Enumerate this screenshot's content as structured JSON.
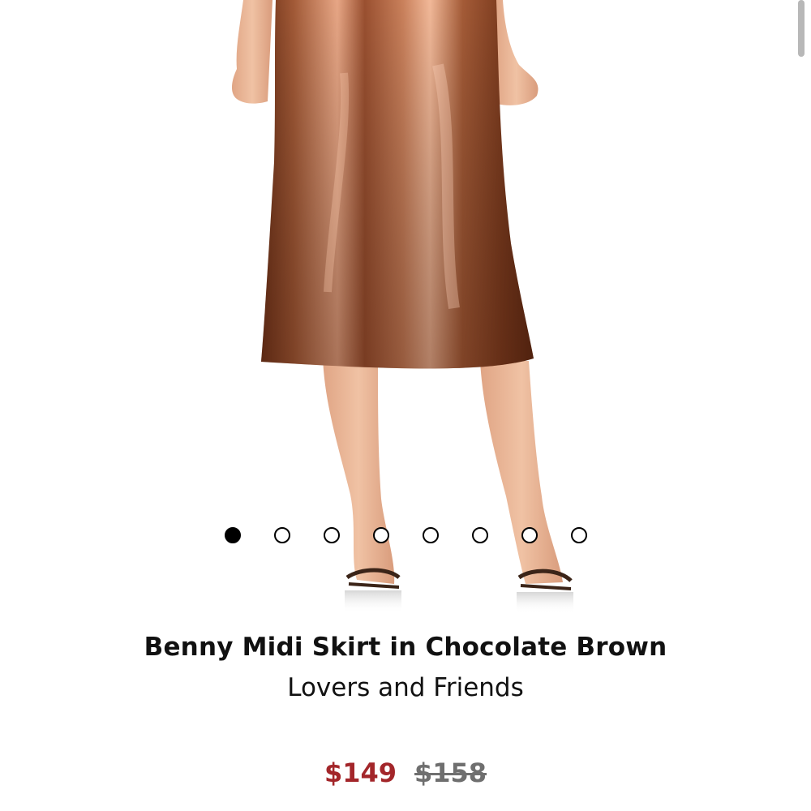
{
  "product": {
    "title": "Benny Midi Skirt in Chocolate Brown",
    "brand": "Lovers and Friends",
    "sale_price": "$149",
    "original_price": "$158",
    "image_icon": "product-photo-skirt",
    "skirt_color": "#8a4a2c",
    "sale_color": "#a3262a"
  },
  "carousel": {
    "total": 8,
    "active_index": 1
  }
}
